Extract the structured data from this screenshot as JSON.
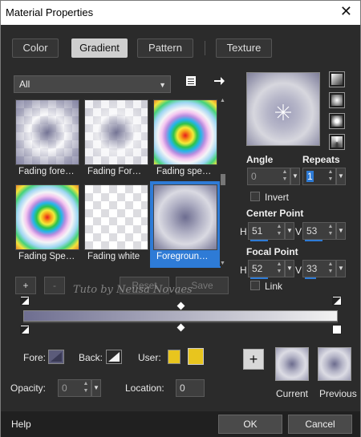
{
  "window": {
    "title": "Material Properties",
    "close_glyph": "✕"
  },
  "tabs": [
    {
      "label": "Color",
      "active": false
    },
    {
      "label": "Gradient",
      "active": true
    },
    {
      "label": "Pattern",
      "active": false
    },
    {
      "label": "Texture",
      "active": false
    }
  ],
  "category": {
    "selected": "All"
  },
  "presets": [
    {
      "label": "Fading fore…"
    },
    {
      "label": "Fading For…"
    },
    {
      "label": "Fading spe…"
    },
    {
      "label": "Fading Spe…"
    },
    {
      "label": "Fading white"
    },
    {
      "label": "Foregroun…",
      "selected": true
    }
  ],
  "angle": {
    "label": "Angle",
    "value": "0"
  },
  "repeats": {
    "label": "Repeats",
    "value": "1"
  },
  "invert": {
    "label": "Invert",
    "checked": false
  },
  "center_point": {
    "label": "Center Point",
    "h_label": "H",
    "h": "51",
    "v_label": "V",
    "v": "53"
  },
  "focal_point": {
    "label": "Focal Point",
    "h_label": "H",
    "h": "52",
    "v_label": "V",
    "v": "33"
  },
  "link": {
    "label": "Link",
    "checked": false
  },
  "gradient_buttons": {
    "add": "+",
    "remove": "-",
    "reset": "Reset",
    "save": "Save"
  },
  "watermark": "Tuto by Neusa Novaes",
  "fore": {
    "label": "Fore:"
  },
  "back": {
    "label": "Back:"
  },
  "user": {
    "label": "User:",
    "color": "#e8c51e"
  },
  "opacity": {
    "label": "Opacity:",
    "value": "0"
  },
  "location": {
    "label": "Location:",
    "value": "0"
  },
  "add_swatch": "+",
  "current": {
    "label": "Current"
  },
  "previous": {
    "label": "Previous"
  },
  "footer": {
    "help": "Help",
    "ok": "OK",
    "cancel": "Cancel"
  },
  "colors": {
    "accent": "#2e7bd6",
    "dark_bg": "#2b2b2b",
    "gradient_start": "#6e6e90",
    "gradient_end": "#f2f2f2"
  }
}
